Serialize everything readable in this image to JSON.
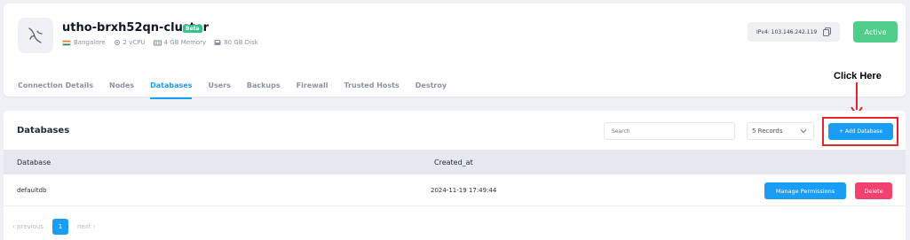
{
  "cluster": {
    "name": "utho-brxh52qn-cluster",
    "badge": "Beta",
    "location": "Bangalore",
    "cpu": "2 vCPU",
    "memory": "4 GB Memory",
    "disk": "80 GB Disk",
    "ip_label": "IPv4: 103.146.242.119",
    "status": "Active"
  },
  "tabs": [
    {
      "label": "Connection Details",
      "active": false
    },
    {
      "label": "Nodes",
      "active": false
    },
    {
      "label": "Databases",
      "active": true
    },
    {
      "label": "Users",
      "active": false
    },
    {
      "label": "Backups",
      "active": false
    },
    {
      "label": "Firewall",
      "active": false
    },
    {
      "label": "Trusted Hosts",
      "active": false
    },
    {
      "label": "Destroy",
      "active": false
    }
  ],
  "annotation": {
    "text": "Click Here",
    "color": "#e8242b"
  },
  "databases": {
    "title": "Databases",
    "search_placeholder": "Search",
    "records_select": "5 Records",
    "add_button": "+ Add Database",
    "columns": [
      "Database",
      "Created_at"
    ],
    "rows": [
      {
        "name": "defaultdb",
        "created_at": "2024-11-19 17:49:44",
        "manage_label": "Manage Permissions",
        "delete_label": "Delete"
      }
    ],
    "pagination": {
      "prev": "‹ previous",
      "page": "1",
      "next": "next ›"
    }
  },
  "colors": {
    "accent": "#1a9df5",
    "active": "#50cd89",
    "danger": "#f1416c"
  }
}
